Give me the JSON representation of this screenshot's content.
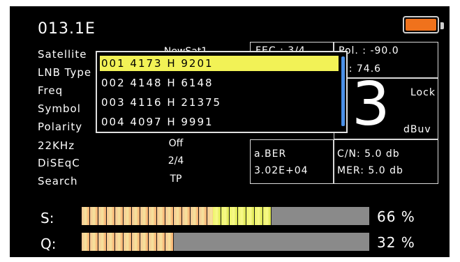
{
  "header": {
    "title": "013.1E",
    "battery_icon": "battery-icon",
    "battery_color": "#f0721c"
  },
  "settings": [
    {
      "label": "Satellite",
      "value": "NewSat1"
    },
    {
      "label": "LNB Type",
      "value": ""
    },
    {
      "label": "Freq",
      "value": ""
    },
    {
      "label": "Symbol",
      "value": ""
    },
    {
      "label": "Polarity",
      "value": ""
    },
    {
      "label": "22KHz",
      "value": "Off"
    },
    {
      "label": "DiSEqC",
      "value": "2/4"
    },
    {
      "label": "Search",
      "value": "TP"
    }
  ],
  "info": {
    "fec": "FEC : 3/4",
    "pol": "Pol. : -90.0",
    "el": "El:  74.6",
    "big_digit": "3",
    "lock": "Lock",
    "unit": "dBuv",
    "ber_label": "a.BER",
    "ber_value": "3.02E+04",
    "cn": "C/N:   5.0 db",
    "mer": "MER:  5.0 db"
  },
  "tp_list": {
    "selected_index": 0,
    "items": [
      "001 4173 H 9201",
      "002 4148 H 6148",
      "003 4116 H 21375",
      "004 4097 H 9991"
    ]
  },
  "meters": {
    "s": {
      "label": "S:",
      "percent_text": "66 %",
      "level": 0.66
    },
    "q": {
      "label": "Q:",
      "percent_text": "32 %",
      "level": 0.32
    }
  }
}
